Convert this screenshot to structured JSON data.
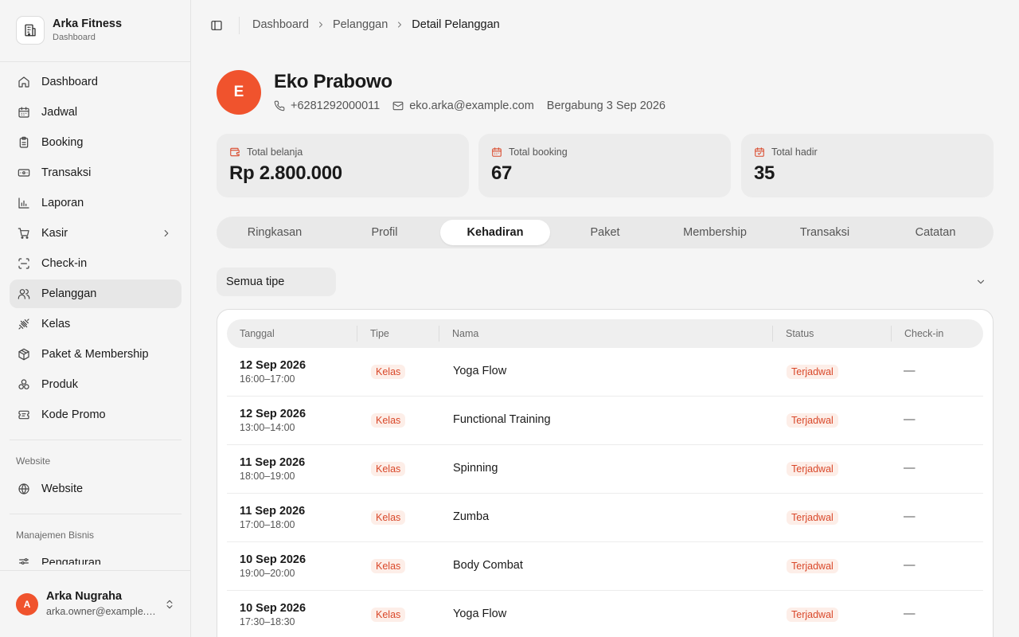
{
  "brand": {
    "name": "Arka Fitness",
    "subtitle": "Dashboard",
    "icon": "building-icon"
  },
  "nav": {
    "items": [
      {
        "label": "Dashboard",
        "icon": "home-icon"
      },
      {
        "label": "Jadwal",
        "icon": "calendar-icon"
      },
      {
        "label": "Booking",
        "icon": "clipboard-icon"
      },
      {
        "label": "Transaksi",
        "icon": "banknote-icon"
      },
      {
        "label": "Laporan",
        "icon": "bar-chart-icon"
      },
      {
        "label": "Kasir",
        "icon": "cart-icon",
        "has_children": true
      },
      {
        "label": "Check-in",
        "icon": "scan-icon"
      },
      {
        "label": "Pelanggan",
        "icon": "users-icon",
        "active": true
      },
      {
        "label": "Kelas",
        "icon": "dumbbell-icon"
      },
      {
        "label": "Paket & Membership",
        "icon": "package-icon"
      },
      {
        "label": "Produk",
        "icon": "boxes-icon"
      },
      {
        "label": "Kode Promo",
        "icon": "ticket-icon"
      }
    ],
    "website_section": "Website",
    "website_items": [
      {
        "label": "Website",
        "icon": "globe-icon"
      }
    ],
    "business_section": "Manajemen Bisnis",
    "business_items": [
      {
        "label": "Pengaturan",
        "icon": "settings-icon"
      }
    ]
  },
  "user": {
    "initial": "A",
    "name": "Arka Nugraha",
    "email": "arka.owner@example.com"
  },
  "breadcrumb": {
    "items": [
      "Dashboard",
      "Pelanggan"
    ],
    "current": "Detail Pelanggan"
  },
  "customer": {
    "initial": "E",
    "name": "Eko Prabowo",
    "phone": "+6281292000011",
    "email": "eko.arka@example.com",
    "joined": "Bergabung 3 Sep 2026"
  },
  "stats": [
    {
      "label": "Total belanja",
      "value": "Rp 2.800.000",
      "icon": "wallet-icon"
    },
    {
      "label": "Total booking",
      "value": "67",
      "icon": "calendar-icon"
    },
    {
      "label": "Total hadir",
      "value": "35",
      "icon": "calendar-check-icon"
    }
  ],
  "tabs": [
    "Ringkasan",
    "Profil",
    "Kehadiran",
    "Paket",
    "Membership",
    "Transaksi",
    "Catatan"
  ],
  "active_tab": "Kehadiran",
  "filter": {
    "value": "Semua tipe"
  },
  "table": {
    "headers": [
      "Tanggal",
      "Tipe",
      "Nama",
      "Status",
      "Check-in"
    ],
    "rows": [
      {
        "date": "12 Sep 2026",
        "time": "16:00–17:00",
        "type": "Kelas",
        "name": "Yoga Flow",
        "status": "Terjadwal",
        "checkin": "—"
      },
      {
        "date": "12 Sep 2026",
        "time": "13:00–14:00",
        "type": "Kelas",
        "name": "Functional Training",
        "status": "Terjadwal",
        "checkin": "—"
      },
      {
        "date": "11 Sep 2026",
        "time": "18:00–19:00",
        "type": "Kelas",
        "name": "Spinning",
        "status": "Terjadwal",
        "checkin": "—"
      },
      {
        "date": "11 Sep 2026",
        "time": "17:00–18:00",
        "type": "Kelas",
        "name": "Zumba",
        "status": "Terjadwal",
        "checkin": "—"
      },
      {
        "date": "10 Sep 2026",
        "time": "19:00–20:00",
        "type": "Kelas",
        "name": "Body Combat",
        "status": "Terjadwal",
        "checkin": "—"
      },
      {
        "date": "10 Sep 2026",
        "time": "17:30–18:30",
        "type": "Kelas",
        "name": "Yoga Flow",
        "status": "Terjadwal",
        "checkin": "—"
      }
    ]
  },
  "colors": {
    "accent": "#f0532d",
    "accent_text": "#d9482a",
    "badge_bg": "#fdeee8"
  }
}
